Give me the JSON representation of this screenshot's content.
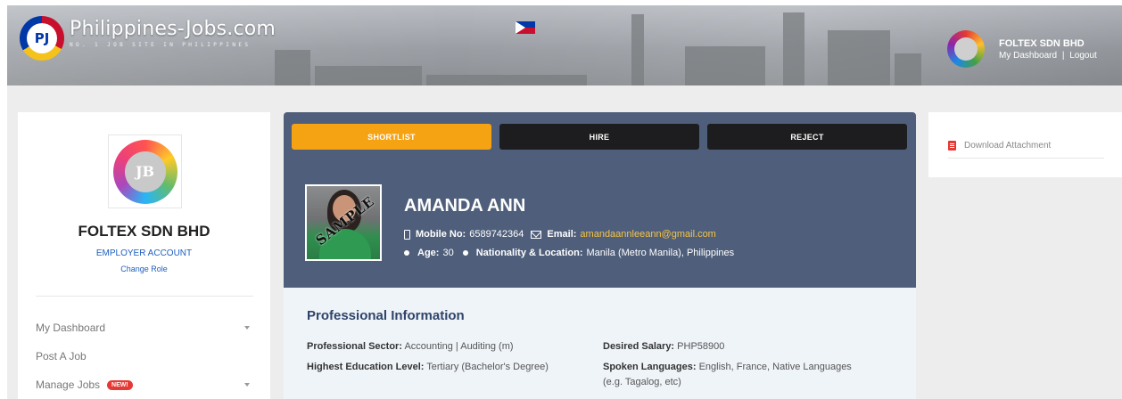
{
  "header": {
    "site_title": "Philippines-Jobs.com",
    "tagline": "NO. 1 JOB SITE IN PHILIPPINES",
    "logo_letters": "PJ",
    "user": {
      "company": "FOLTEX SDN BHD",
      "dashboard_link": "My Dashboard",
      "separator": "|",
      "logout_link": "Logout"
    }
  },
  "sidebar": {
    "company_name": "FOLTEX SDN BHD",
    "account_type": "EMPLOYER ACCOUNT",
    "change_role": "Change Role",
    "logo_letters": "JB",
    "items": [
      {
        "label": "My Dashboard",
        "has_caret": true
      },
      {
        "label": "Post A Job",
        "has_caret": false
      },
      {
        "label": "Manage Jobs",
        "badge": "NEW!",
        "has_caret": true
      }
    ]
  },
  "actions": {
    "shortlist": "SHORTLIST",
    "hire": "HIRE",
    "reject": "REJECT"
  },
  "candidate": {
    "name": "AMANDA ANN",
    "photo_stamp": "SAMPLE",
    "mobile_label": "Mobile No:",
    "mobile": "6589742364",
    "email_label": "Email:",
    "email": "amandaannleeann@gmail.com",
    "age_label": "Age:",
    "age": "30",
    "nationality_label": "Nationality & Location:",
    "nationality": "Manila (Metro Manila), Philippines"
  },
  "professional": {
    "title": "Professional Information",
    "sector_label": "Professional Sector:",
    "sector": "Accounting | Auditing (m)",
    "education_label": "Highest Education Level:",
    "education": "Tertiary (Bachelor's Degree)",
    "salary_label": "Desired Salary:",
    "salary": "PHP58900",
    "languages_label": "Spoken Languages:",
    "languages_line1": "English, France, Native Languages",
    "languages_line2": "(e.g. Tagalog, etc)"
  },
  "attachment": {
    "label": "Download Attachment"
  },
  "colors": {
    "header_panel": "#4f5f7b",
    "shortlist": "#f6a313",
    "dark_button": "#1d1d1f",
    "email": "#f6c343",
    "link": "#1f5fbf",
    "section_title": "#2f4369",
    "badge": "#e53935"
  }
}
